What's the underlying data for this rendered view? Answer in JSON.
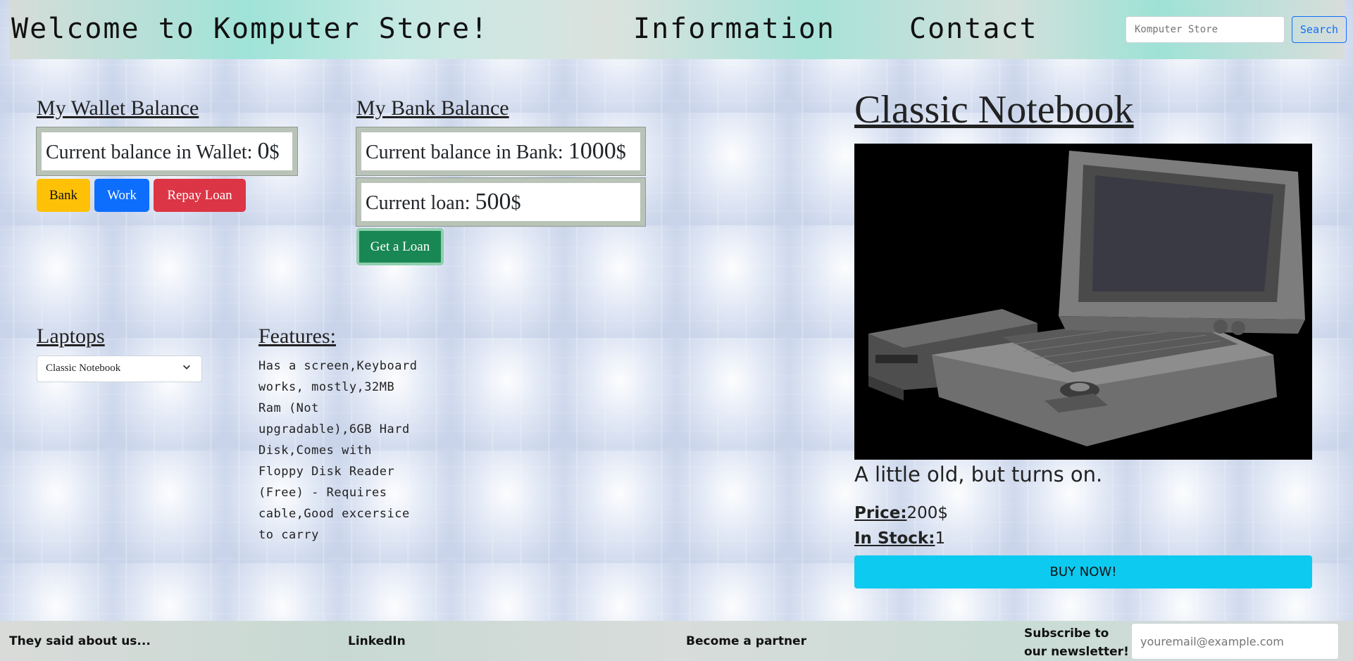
{
  "header": {
    "brand": "Welcome to Komputer Store!",
    "nav": [
      "Information",
      "Contact"
    ],
    "search": {
      "placeholder": "Komputer Store",
      "button_label": "Search"
    }
  },
  "wallet": {
    "title": "My Wallet Balance",
    "label": "Current balance in Wallet: ",
    "amount": "0",
    "currency": "$",
    "buttons": {
      "bank": "Bank",
      "work": "Work",
      "repay": "Repay Loan"
    }
  },
  "bank": {
    "title": "My Bank Balance",
    "balance_label": "Current balance in Bank: ",
    "balance_amount": "1000",
    "loan_label": "Current loan: ",
    "loan_amount": "500",
    "currency": "$",
    "loan_button": "Get a Loan"
  },
  "laptops": {
    "title": "Laptops",
    "selected": "Classic Notebook",
    "features_title": "Features:",
    "features_text": "Has a screen,Keyboard works, mostly,32MB Ram (Not upgradable),6GB Hard Disk,Comes with Floppy Disk Reader (Free) - Requires cable,Good excersice to carry"
  },
  "product": {
    "title": "Classic Notebook",
    "image": "laptop-photo",
    "description": "A little old, but turns on.",
    "price_label": "Price:",
    "price_value": "200$",
    "stock_label": "In Stock:",
    "stock_value": "1",
    "buy_label": "BUY NOW!"
  },
  "footer": {
    "items": [
      "They said about us...",
      "LinkedIn",
      "Become a partner"
    ],
    "subscribe_label": "Subscribe to our newsletter!",
    "email_placeholder": "youremail@example.com"
  },
  "colors": {
    "bank_button": "#ffc107",
    "work_button": "#0d6efd",
    "repay_button": "#dc3545",
    "loan_button": "#198754",
    "buy_button": "#0dcaf0"
  }
}
